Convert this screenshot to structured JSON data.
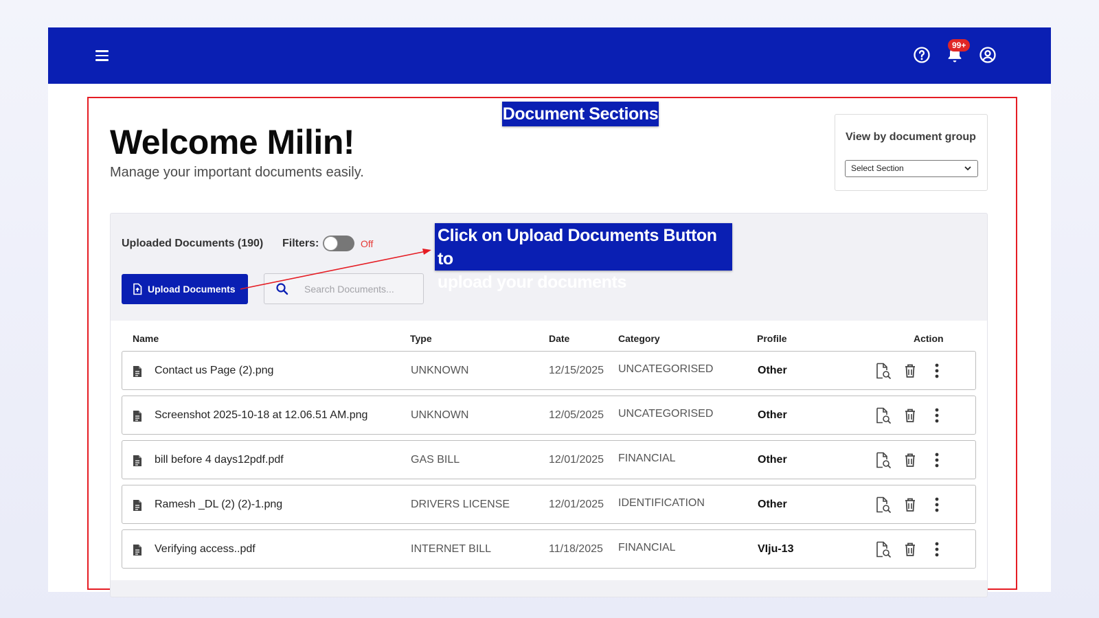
{
  "header": {
    "menu_icon": "hamburger-menu-icon",
    "help_icon": "help-circle-icon",
    "notification_icon": "bell-icon",
    "notification_badge": "99+",
    "account_icon": "account-circle-icon"
  },
  "annotations": {
    "section_title": "Document Sections",
    "tip_line1": "Click on Upload Documents Button to",
    "tip_line2": "upload your documents",
    "accent_color": "#0a1fb3",
    "frame_color": "#e51c23"
  },
  "welcome": {
    "title": "Welcome Milin!",
    "subtitle": "Manage your important documents easily."
  },
  "group_filter": {
    "label": "View by document group",
    "selected": "Select Section"
  },
  "toolbar": {
    "count_label": "Uploaded Documents (190)",
    "filters_label": "Filters:",
    "filters_state": "Off",
    "upload_label": "Upload Documents",
    "search_placeholder": "Search Documents..."
  },
  "table": {
    "headers": {
      "name": "Name",
      "type": "Type",
      "date": "Date",
      "category": "Category",
      "profile": "Profile",
      "action": "Action"
    },
    "rows": [
      {
        "name": "Contact us Page (2).png",
        "type": "UNKNOWN",
        "date": "12/15/2025",
        "category": "UNCATEGORISED",
        "profile": "Other"
      },
      {
        "name": "Screenshot 2025-10-18 at 12.06.51 AM.png",
        "type": "UNKNOWN",
        "date": "12/05/2025",
        "category": "UNCATEGORISED",
        "profile": "Other"
      },
      {
        "name": "bill before 4 days12pdf.pdf",
        "type": "GAS BILL",
        "date": "12/01/2025",
        "category": "FINANCIAL",
        "profile": "Other"
      },
      {
        "name": "Ramesh _DL (2) (2)-1.png",
        "type": "DRIVERS LICENSE",
        "date": "12/01/2025",
        "category": "IDENTIFICATION",
        "profile": "Other"
      },
      {
        "name": "Verifying access..pdf",
        "type": "INTERNET BILL",
        "date": "11/18/2025",
        "category": "FINANCIAL",
        "profile": "VIju-13"
      }
    ]
  }
}
